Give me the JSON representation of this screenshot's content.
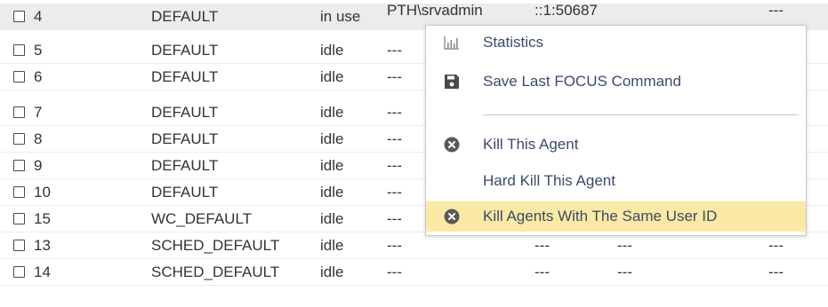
{
  "rows": [
    {
      "id": "4",
      "service": "DEFAULT",
      "status": "in use",
      "user": "PTH\\srvadmin",
      "address": "::1:50687",
      "extra1": "",
      "extra2": "---"
    },
    {
      "id": "5",
      "service": "DEFAULT",
      "status": "idle",
      "user": "---",
      "address": "",
      "extra1": "",
      "extra2": ""
    },
    {
      "id": "6",
      "service": "DEFAULT",
      "status": "idle",
      "user": "---",
      "address": "",
      "extra1": "",
      "extra2": ""
    },
    {
      "id": "7",
      "service": "DEFAULT",
      "status": "idle",
      "user": "---",
      "address": "",
      "extra1": "",
      "extra2": ""
    },
    {
      "id": "8",
      "service": "DEFAULT",
      "status": "idle",
      "user": "---",
      "address": "",
      "extra1": "",
      "extra2": ""
    },
    {
      "id": "9",
      "service": "DEFAULT",
      "status": "idle",
      "user": "---",
      "address": "",
      "extra1": "",
      "extra2": ""
    },
    {
      "id": "10",
      "service": "DEFAULT",
      "status": "idle",
      "user": "---",
      "address": "",
      "extra1": "",
      "extra2": ""
    },
    {
      "id": "15",
      "service": "WC_DEFAULT",
      "status": "idle",
      "user": "---",
      "address": "",
      "extra1": "",
      "extra2": ""
    },
    {
      "id": "13",
      "service": "SCHED_DEFAULT",
      "status": "idle",
      "user": "---",
      "address": "---",
      "extra1": "---",
      "extra2": "---"
    },
    {
      "id": "14",
      "service": "SCHED_DEFAULT",
      "status": "idle",
      "user": "---",
      "address": "---",
      "extra1": "---",
      "extra2": "---"
    }
  ],
  "context_menu": {
    "statistics": "Statistics",
    "save_last_command": "Save Last FOCUS Command",
    "kill_agent": "Kill This Agent",
    "hard_kill_agent": "Hard Kill This Agent",
    "kill_same_user": "Kill Agents With The Same User ID"
  },
  "colors": {
    "highlight_row": "#ececec",
    "menu_active": "#fbe9a4",
    "menu_text": "#3a4a6a",
    "icon_dark": "#4a4a4a"
  }
}
